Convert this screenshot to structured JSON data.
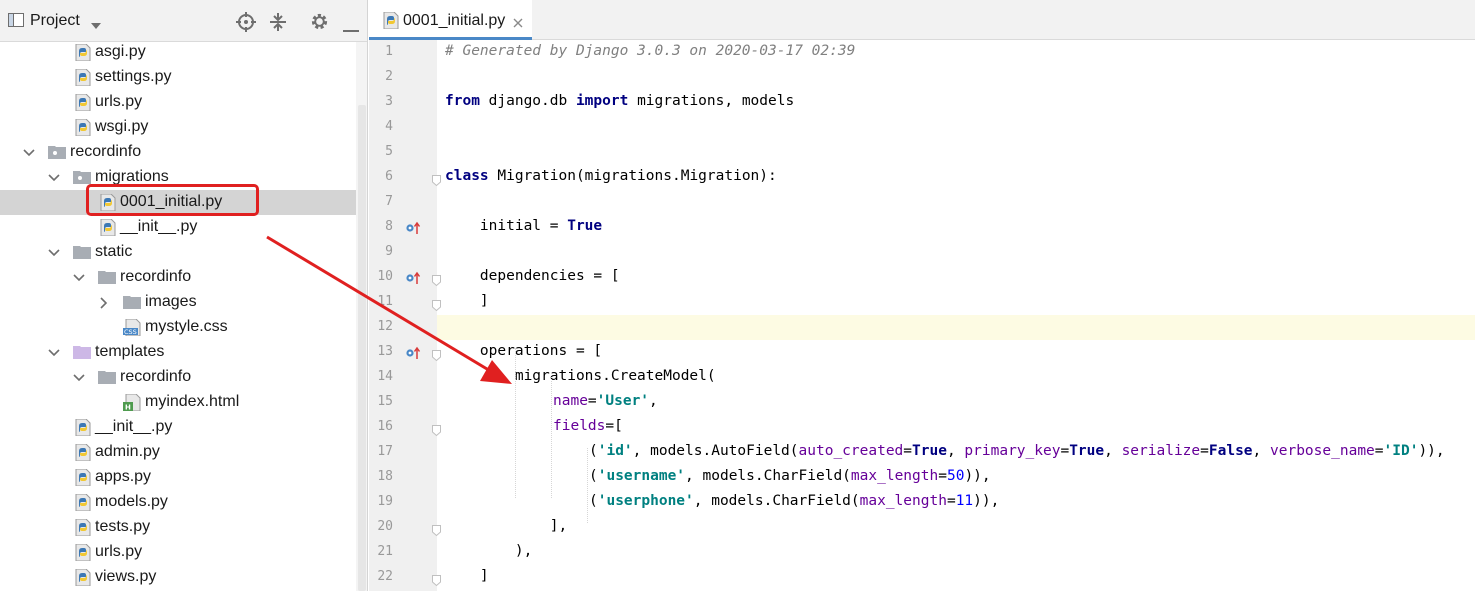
{
  "project_panel": {
    "title": "Project",
    "tree": [
      {
        "label": "asgi.py",
        "icon": "python-file-icon"
      },
      {
        "label": "settings.py",
        "icon": "python-file-icon"
      },
      {
        "label": "urls.py",
        "icon": "python-file-icon"
      },
      {
        "label": "wsgi.py",
        "icon": "python-file-icon"
      },
      {
        "label": "recordinfo",
        "icon": "package-folder-icon",
        "expanded": true
      },
      {
        "label": "migrations",
        "icon": "package-folder-icon",
        "expanded": true
      },
      {
        "label": "0001_initial.py",
        "icon": "python-file-icon",
        "selected": true
      },
      {
        "label": "__init__.py",
        "icon": "python-file-icon"
      },
      {
        "label": "static",
        "icon": "folder-icon",
        "expanded": true
      },
      {
        "label": "recordinfo",
        "icon": "folder-icon",
        "expanded": true
      },
      {
        "label": "images",
        "icon": "folder-icon",
        "expanded": false
      },
      {
        "label": "mystyle.css",
        "icon": "css-file-icon"
      },
      {
        "label": "templates",
        "icon": "templates-folder-icon",
        "expanded": true
      },
      {
        "label": "recordinfo",
        "icon": "folder-icon",
        "expanded": true
      },
      {
        "label": "myindex.html",
        "icon": "html-file-icon"
      },
      {
        "label": "__init__.py",
        "icon": "python-file-icon"
      },
      {
        "label": "admin.py",
        "icon": "python-file-icon"
      },
      {
        "label": "apps.py",
        "icon": "python-file-icon"
      },
      {
        "label": "models.py",
        "icon": "python-file-icon"
      },
      {
        "label": "tests.py",
        "icon": "python-file-icon"
      },
      {
        "label": "urls.py",
        "icon": "python-file-icon"
      },
      {
        "label": "views.py",
        "icon": "python-file-icon"
      }
    ]
  },
  "editor": {
    "tab": {
      "label": "0001_initial.py"
    },
    "highlighted_line": 12,
    "line_numbers": [
      "1",
      "2",
      "3",
      "4",
      "5",
      "6",
      "7",
      "8",
      "9",
      "10",
      "11",
      "12",
      "13",
      "14",
      "15",
      "16",
      "17",
      "18",
      "19",
      "20",
      "21",
      "22"
    ],
    "code": {
      "l1": "# Generated by Django 3.0.3 on 2020-03-17 02:39",
      "l3": {
        "kw1": "from",
        "mod": " django.db ",
        "kw2": "import",
        "rest": " migrations, models"
      },
      "l6": {
        "kw": "class",
        "rest": " Migration(migrations.Migration):"
      },
      "l8": {
        "a": "    initial = ",
        "b": "True"
      },
      "l10": "    dependencies = [",
      "l11": "    ]",
      "l13": "    operations = [",
      "l14": "        migrations.CreateModel(",
      "l15": {
        "k": "name",
        "eq": "=",
        "s": "'User'",
        "end": ","
      },
      "l16": {
        "k": "fields",
        "rest": "=["
      },
      "l17": {
        "p1": "('",
        "s1": "'id'",
        "p2": ", models.AutoField(",
        "k1": "auto_created",
        "e1": "=",
        "v1": "True",
        "c1": ", ",
        "k2": "primary_key",
        "e2": "=",
        "v2": "True",
        "c2": ", ",
        "k3": "serialize",
        "e3": "=",
        "v3": "False",
        "c3": ", ",
        "k4": "verbose_name",
        "e4": "=",
        "s4": "'ID'",
        "end": ")),"
      },
      "l18": {
        "p1": "(",
        "s1": "'username'",
        "p2": ", models.CharField(",
        "k1": "max_length",
        "e1": "=",
        "n1": "50",
        "end": ")),"
      },
      "l19": {
        "p1": "(",
        "s1": "'userphone'",
        "p2": ", models.CharField(",
        "k1": "max_length",
        "e1": "=",
        "n1": "11",
        "end": ")),"
      },
      "l20": "            ],",
      "l21": "        ),",
      "l22": "    ]"
    }
  },
  "colors": {
    "selection": "#d4d4d4",
    "annotation_red": "#e02020",
    "keyword": "#000080",
    "string": "#008080",
    "kwarg": "#660099",
    "number": "#0000ff",
    "comment": "#808080"
  }
}
